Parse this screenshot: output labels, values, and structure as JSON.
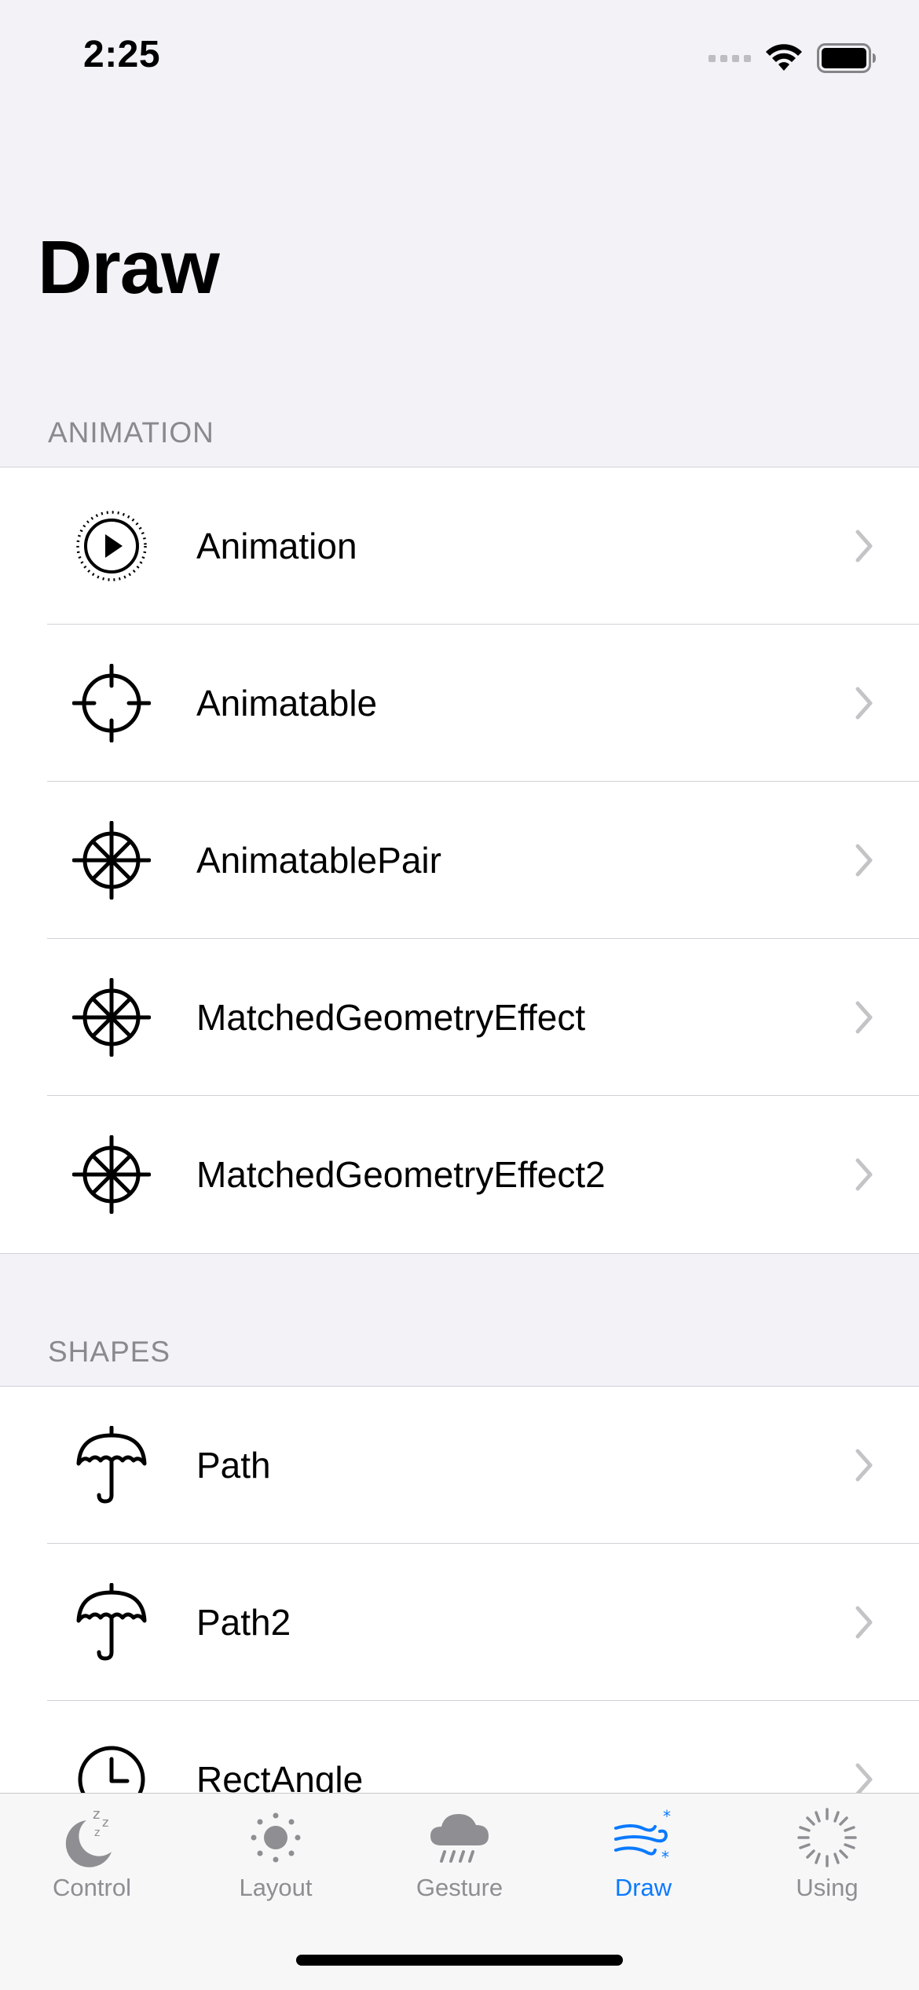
{
  "status": {
    "time": "2:25"
  },
  "title": "Draw",
  "sections": [
    {
      "header": "ANIMATION",
      "items": [
        {
          "label": "Animation",
          "icon": "play-circle-dotted-icon"
        },
        {
          "label": "Animatable",
          "icon": "crosshair-icon"
        },
        {
          "label": "AnimatablePair",
          "icon": "helm-icon"
        },
        {
          "label": "MatchedGeometryEffect",
          "icon": "helm-icon"
        },
        {
          "label": "MatchedGeometryEffect2",
          "icon": "helm-icon"
        }
      ]
    },
    {
      "header": "SHAPES",
      "items": [
        {
          "label": "Path",
          "icon": "umbrella-icon"
        },
        {
          "label": "Path2",
          "icon": "umbrella-icon"
        },
        {
          "label": "RectAngle",
          "icon": "clock-icon"
        }
      ]
    }
  ],
  "tabs": [
    {
      "label": "Control",
      "icon": "moon-zzz-icon",
      "active": false
    },
    {
      "label": "Layout",
      "icon": "sun-icon",
      "active": false
    },
    {
      "label": "Gesture",
      "icon": "cloud-rain-icon",
      "active": false
    },
    {
      "label": "Draw",
      "icon": "wind-snow-icon",
      "active": true
    },
    {
      "label": "Using",
      "icon": "spinner-icon",
      "active": false
    }
  ],
  "colors": {
    "accent": "#0a7aff",
    "inactive": "#8e8e93",
    "background": "#f2f2f7"
  }
}
